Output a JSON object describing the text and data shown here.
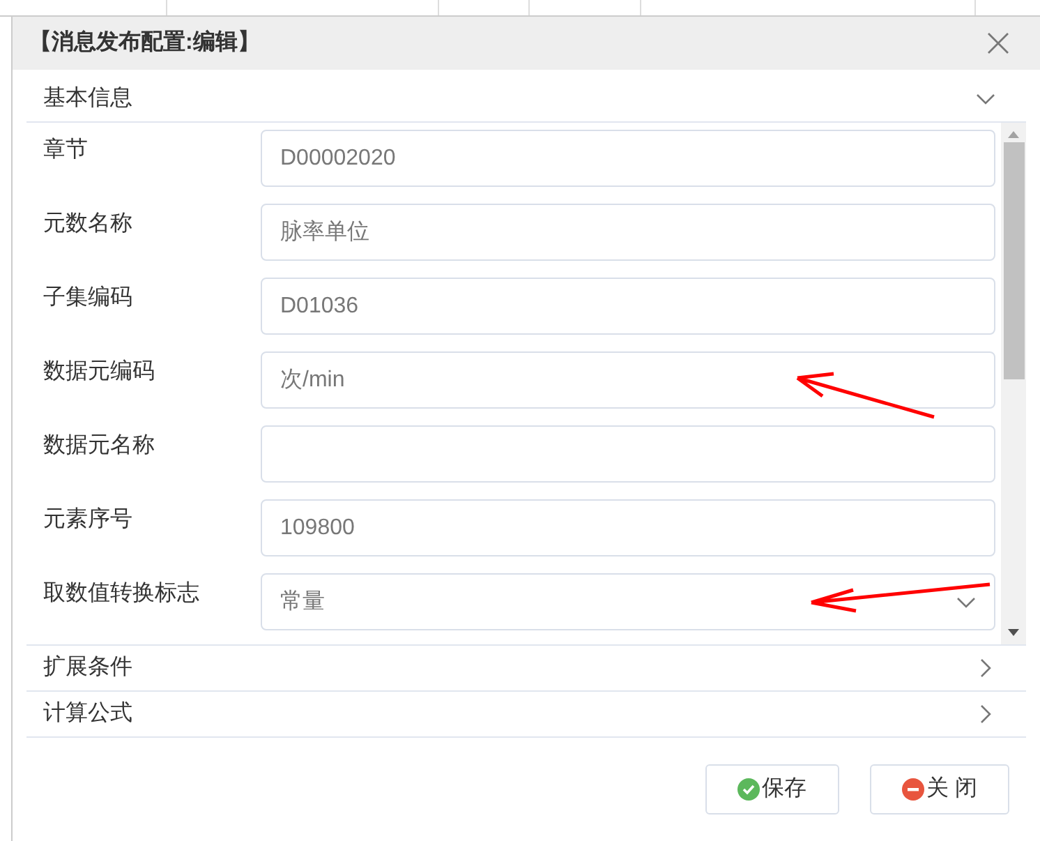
{
  "dialog": {
    "title": "【消息发布配置:编辑】"
  },
  "sections": [
    {
      "title": "基本信息",
      "expanded": true
    },
    {
      "title": "扩展条件",
      "expanded": false
    },
    {
      "title": "计算公式",
      "expanded": false
    }
  ],
  "fields": [
    {
      "label": "章节",
      "kind": "input",
      "value": "D00002020"
    },
    {
      "label": "元数名称",
      "kind": "input",
      "value": "脉率单位"
    },
    {
      "label": "子集编码",
      "kind": "input",
      "value": "D01036"
    },
    {
      "label": "数据元编码",
      "kind": "input",
      "value": "次/min"
    },
    {
      "label": "数据元名称",
      "kind": "input"
    },
    {
      "label": "元素序号",
      "kind": "input",
      "value": "109800"
    },
    {
      "label": "取数值转换标志",
      "kind": "select",
      "value": "常量"
    }
  ],
  "buttons": [
    {
      "label": "保存",
      "kind": "save"
    },
    {
      "label": "关 闭",
      "kind": "close"
    }
  ]
}
